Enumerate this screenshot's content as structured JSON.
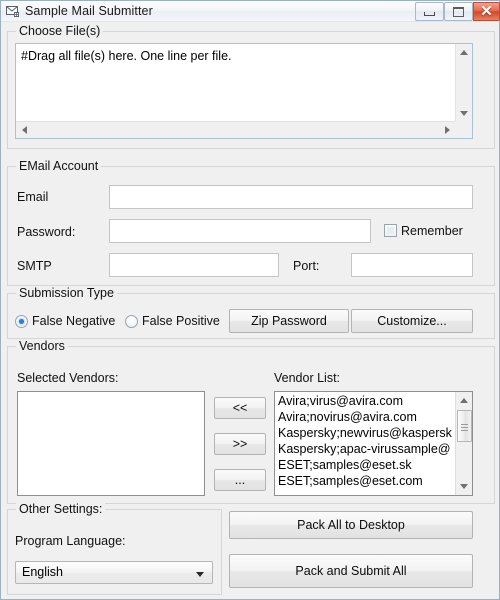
{
  "window": {
    "title": "Sample Mail Submitter",
    "icon": "mail-envelope-icon",
    "controls": {
      "minimize": "minimize-icon",
      "maximize": "maximize-icon",
      "close": "✕"
    }
  },
  "choose_files": {
    "legend": "Choose File(s)",
    "textarea_value": "#Drag all file(s) here. One line per file.",
    "placeholder": ""
  },
  "email_account": {
    "legend": "EMail Account",
    "email_label": "Email",
    "email_value": "",
    "password_label": "Password:",
    "password_value": "",
    "remember_label": "Remember",
    "remember_checked": false,
    "smtp_label": "SMTP",
    "smtp_value": "",
    "port_label": "Port:",
    "port_value": ""
  },
  "submission_type": {
    "legend": "Submission Type",
    "options": [
      {
        "label": "False Negative",
        "selected": true
      },
      {
        "label": "False Positive",
        "selected": false
      }
    ],
    "zip_password_button": "Zip Password",
    "customize_button": "Customize..."
  },
  "vendors": {
    "legend": "Vendors",
    "selected_label": "Selected Vendors:",
    "selected_items": [],
    "vendor_list_label": "Vendor List:",
    "vendor_list_items": [
      "Avira;virus@avira.com",
      "Avira;novirus@avira.com",
      "Kaspersky;newvirus@kaspersk",
      "Kaspersky;apac-virussample@",
      "ESET;samples@eset.sk",
      "ESET;samples@eset.com"
    ],
    "move_left_button": "<<",
    "move_right_button": ">>",
    "more_button": "..."
  },
  "other_settings": {
    "legend": "Other Settings:",
    "language_label": "Program Language:",
    "language_value": "English"
  },
  "actions": {
    "pack_all_button": "Pack All to Desktop",
    "pack_submit_button": "Pack and Submit All"
  },
  "colors": {
    "accent": "#2a7fd4",
    "close_button": "#d2492c",
    "window_bg": "#f0f0f0"
  }
}
